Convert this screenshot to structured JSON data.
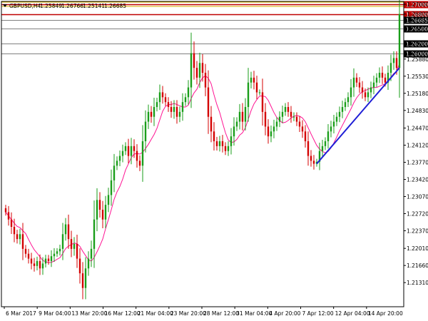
{
  "chart_title": {
    "symbol": "GBPUSD,H4",
    "open": "1.25849",
    "high": "1.26766",
    "low": "1.25141",
    "close": "1.26685"
  },
  "colors": {
    "background": "#ffffff",
    "candle_bull": "#1a9e1a",
    "candle_bear": "#d40000",
    "moving_average": "#ff1493",
    "trendline": "#1f1fd6",
    "resistance_lines": "#c00000",
    "gray_levels": "#808080",
    "axis": "#000000"
  },
  "chart_data": {
    "type": "candlestick",
    "symbol": "GBPUSD",
    "timeframe": "H4",
    "ylim": [
      1.2105,
      1.27
    ],
    "y_ticks": [
      "1.27000",
      "1.26800",
      "1.26685",
      "1.26500",
      "1.26200",
      "1.26000",
      "1.25880",
      "1.25530",
      "1.25180",
      "1.24830",
      "1.24470",
      "1.24120",
      "1.23770",
      "1.23420",
      "1.23070",
      "1.22720",
      "1.22370",
      "1.22010",
      "1.21660",
      "1.21310"
    ],
    "x_ticks": [
      "6 Mar 2017",
      "9 Mar 04:00",
      "13 Mar 20:00",
      "16 Mar 12:00",
      "21 Mar 04:00",
      "23 Mar 20:00",
      "28 Mar 12:00",
      "31 Mar 04:00",
      "4 Apr 20:00",
      "7 Apr 12:00",
      "12 Apr 04:00",
      "14 Apr 20:00"
    ],
    "horizontal_levels": [
      {
        "price": 1.27,
        "label": "1.27000",
        "style": "resistance"
      },
      {
        "price": 1.268,
        "label": "1.26800",
        "style": "resistance"
      },
      {
        "price": 1.265,
        "label": "1.26500",
        "style": "level"
      },
      {
        "price": 1.262,
        "label": "1.26200",
        "style": "level"
      },
      {
        "price": 1.26,
        "label": "1.26000",
        "style": "level"
      }
    ],
    "current_price": {
      "price": 1.26685,
      "label": "1.26685"
    },
    "trendline": {
      "from": {
        "bar": 109,
        "price": 1.2374
      },
      "to": {
        "bar": 138,
        "price": 1.257
      }
    },
    "moving_average": {
      "type": "MA"
    },
    "closes": [
      1.2275,
      1.226,
      1.2245,
      1.223,
      1.222,
      1.223,
      1.22,
      1.219,
      1.218,
      1.217,
      1.2165,
      1.2175,
      1.216,
      1.217,
      1.218,
      1.2175,
      1.2185,
      1.219,
      1.2195,
      1.22,
      1.223,
      1.225,
      1.222,
      1.22,
      1.221,
      1.218,
      1.215,
      1.212,
      1.216,
      1.218,
      1.22,
      1.226,
      1.23,
      1.228,
      1.226,
      1.229,
      1.231,
      1.234,
      1.237,
      1.238,
      1.239,
      1.24,
      1.241,
      1.239,
      1.241,
      1.24,
      1.238,
      1.237,
      1.242,
      1.246,
      1.248,
      1.247,
      1.249,
      1.25,
      1.252,
      1.251,
      1.25,
      1.249,
      1.248,
      1.249,
      1.247,
      1.248,
      1.25,
      1.251,
      1.253,
      1.26,
      1.257,
      1.255,
      1.258,
      1.256,
      1.253,
      1.247,
      1.244,
      1.242,
      1.241,
      1.242,
      1.241,
      1.24,
      1.241,
      1.243,
      1.245,
      1.246,
      1.248,
      1.246,
      1.249,
      1.254,
      1.255,
      1.254,
      1.252,
      1.252,
      1.248,
      1.245,
      1.243,
      1.244,
      1.245,
      1.246,
      1.247,
      1.248,
      1.249,
      1.248,
      1.247,
      1.247,
      1.246,
      1.245,
      1.244,
      1.242,
      1.239,
      1.238,
      1.2374,
      1.2378,
      1.24,
      1.241,
      1.242,
      1.244,
      1.245,
      1.246,
      1.247,
      1.248,
      1.249,
      1.25,
      1.251,
      1.253,
      1.255,
      1.254,
      1.253,
      1.252,
      1.251,
      1.252,
      1.253,
      1.254,
      1.255,
      1.256,
      1.255,
      1.254,
      1.256,
      1.258,
      1.259,
      1.257,
      1.268
    ]
  }
}
